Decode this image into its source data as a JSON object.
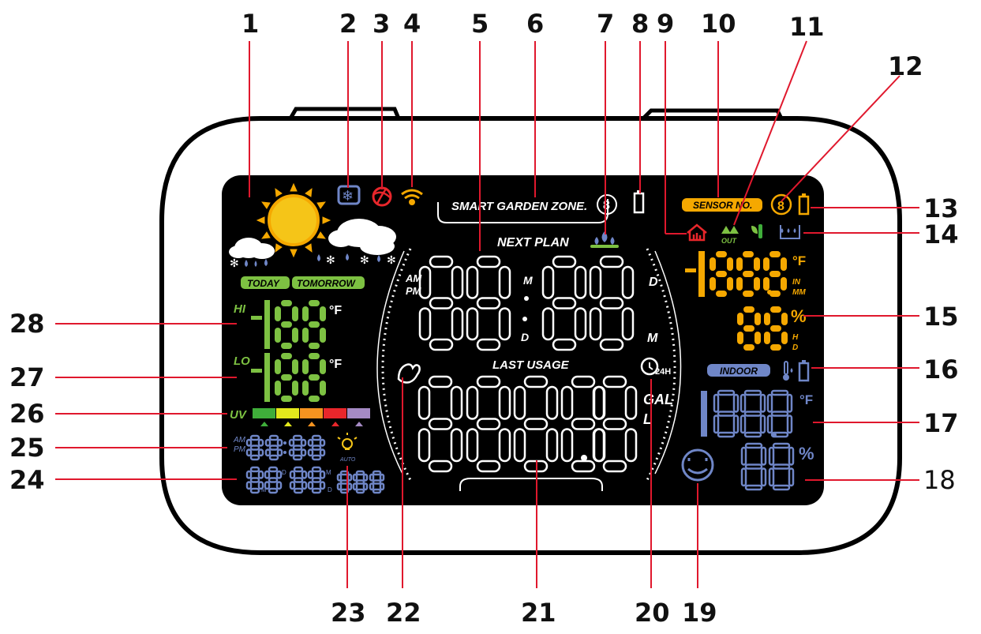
{
  "callouts": {
    "n1": "1",
    "n2": "2",
    "n3": "3",
    "n4": "4",
    "n5": "5",
    "n6": "6",
    "n7": "7",
    "n8": "8",
    "n9": "9",
    "n10": "10",
    "n11": "11",
    "n12": "12",
    "n13": "13",
    "n14": "14",
    "n15": "15",
    "n16": "16",
    "n17": "17",
    "n18": "18",
    "n19": "19",
    "n20": "20",
    "n21": "21",
    "n22": "22",
    "n23": "23",
    "n24": "24",
    "n25": "25",
    "n26": "26",
    "n27": "27",
    "n28": "28"
  },
  "display": {
    "zone_label": "SMART GARDEN  ZONE.",
    "zone_digit": "8",
    "next_plan": "NEXT PLAN",
    "last_usage": "LAST USAGE",
    "time_main": "88:88",
    "usage_main": "8888.8",
    "am": "AM",
    "pm": "PM",
    "m_small": "M",
    "d_small": "D",
    "d_right": "D",
    "m_right": "M",
    "gal": "GAL",
    "l": "L",
    "today": "TODAY",
    "tomorrow": "TOMORROW",
    "hi": "HI",
    "lo": "LO",
    "hi_value": "-188",
    "lo_value": "-188",
    "deg_f": "°F",
    "uv": "UV",
    "clock_small": "88:88",
    "date_small_1": "28",
    "date_small_2": "28",
    "date_year": "888",
    "auto": "AUTO",
    "sensor_no": "SENSOR NO.",
    "sensor_digit": "8",
    "out": "OUT",
    "outdoor_value": "-188.8",
    "in": "IN",
    "mm": "MM",
    "outdoor_humidity": "88",
    "percent": "%",
    "h": "H",
    "indoor": "INDOOR",
    "indoor_value": "188.8",
    "indoor_humidity": "88",
    "h24": "24H"
  },
  "colors": {
    "bezel": "#ffffff",
    "screen": "#000000",
    "leader_line": "#e0182d",
    "green": "#7dc142",
    "orange": "#f5a800",
    "yellow": "#ffd21a",
    "blue_indoor": "#6f86c7",
    "red_icon": "#e8262b",
    "uv_colors": [
      "#3fae3a",
      "#e3e81c",
      "#f59320",
      "#e8262b",
      "#a58ac4"
    ]
  }
}
